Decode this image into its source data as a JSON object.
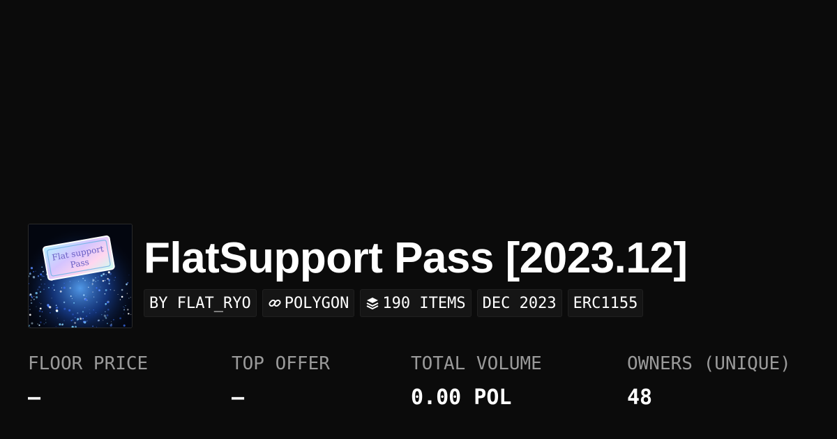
{
  "collection": {
    "title": "FlatSupport Pass [2023.12]",
    "thumbnail_text": [
      "Flat support",
      "Pass"
    ],
    "tags": [
      {
        "label": "BY FLAT_RYO",
        "icon": null
      },
      {
        "label": "POLYGON",
        "icon": "chain-link-icon"
      },
      {
        "label": "190 ITEMS",
        "icon": "layers-icon"
      },
      {
        "label": "DEC 2023",
        "icon": null
      },
      {
        "label": "ERC1155",
        "icon": null
      }
    ]
  },
  "stats": [
    {
      "label": "FLOOR PRICE",
      "value": "–"
    },
    {
      "label": "TOP OFFER",
      "value": "–"
    },
    {
      "label": "TOTAL VOLUME",
      "value": "0.00 POL"
    },
    {
      "label": "OWNERS (UNIQUE)",
      "value": "48"
    }
  ],
  "colors": {
    "background": "#0b0b0b",
    "tag_background": "#151515",
    "label_gray": "#9a9a9a",
    "text": "#ffffff"
  }
}
